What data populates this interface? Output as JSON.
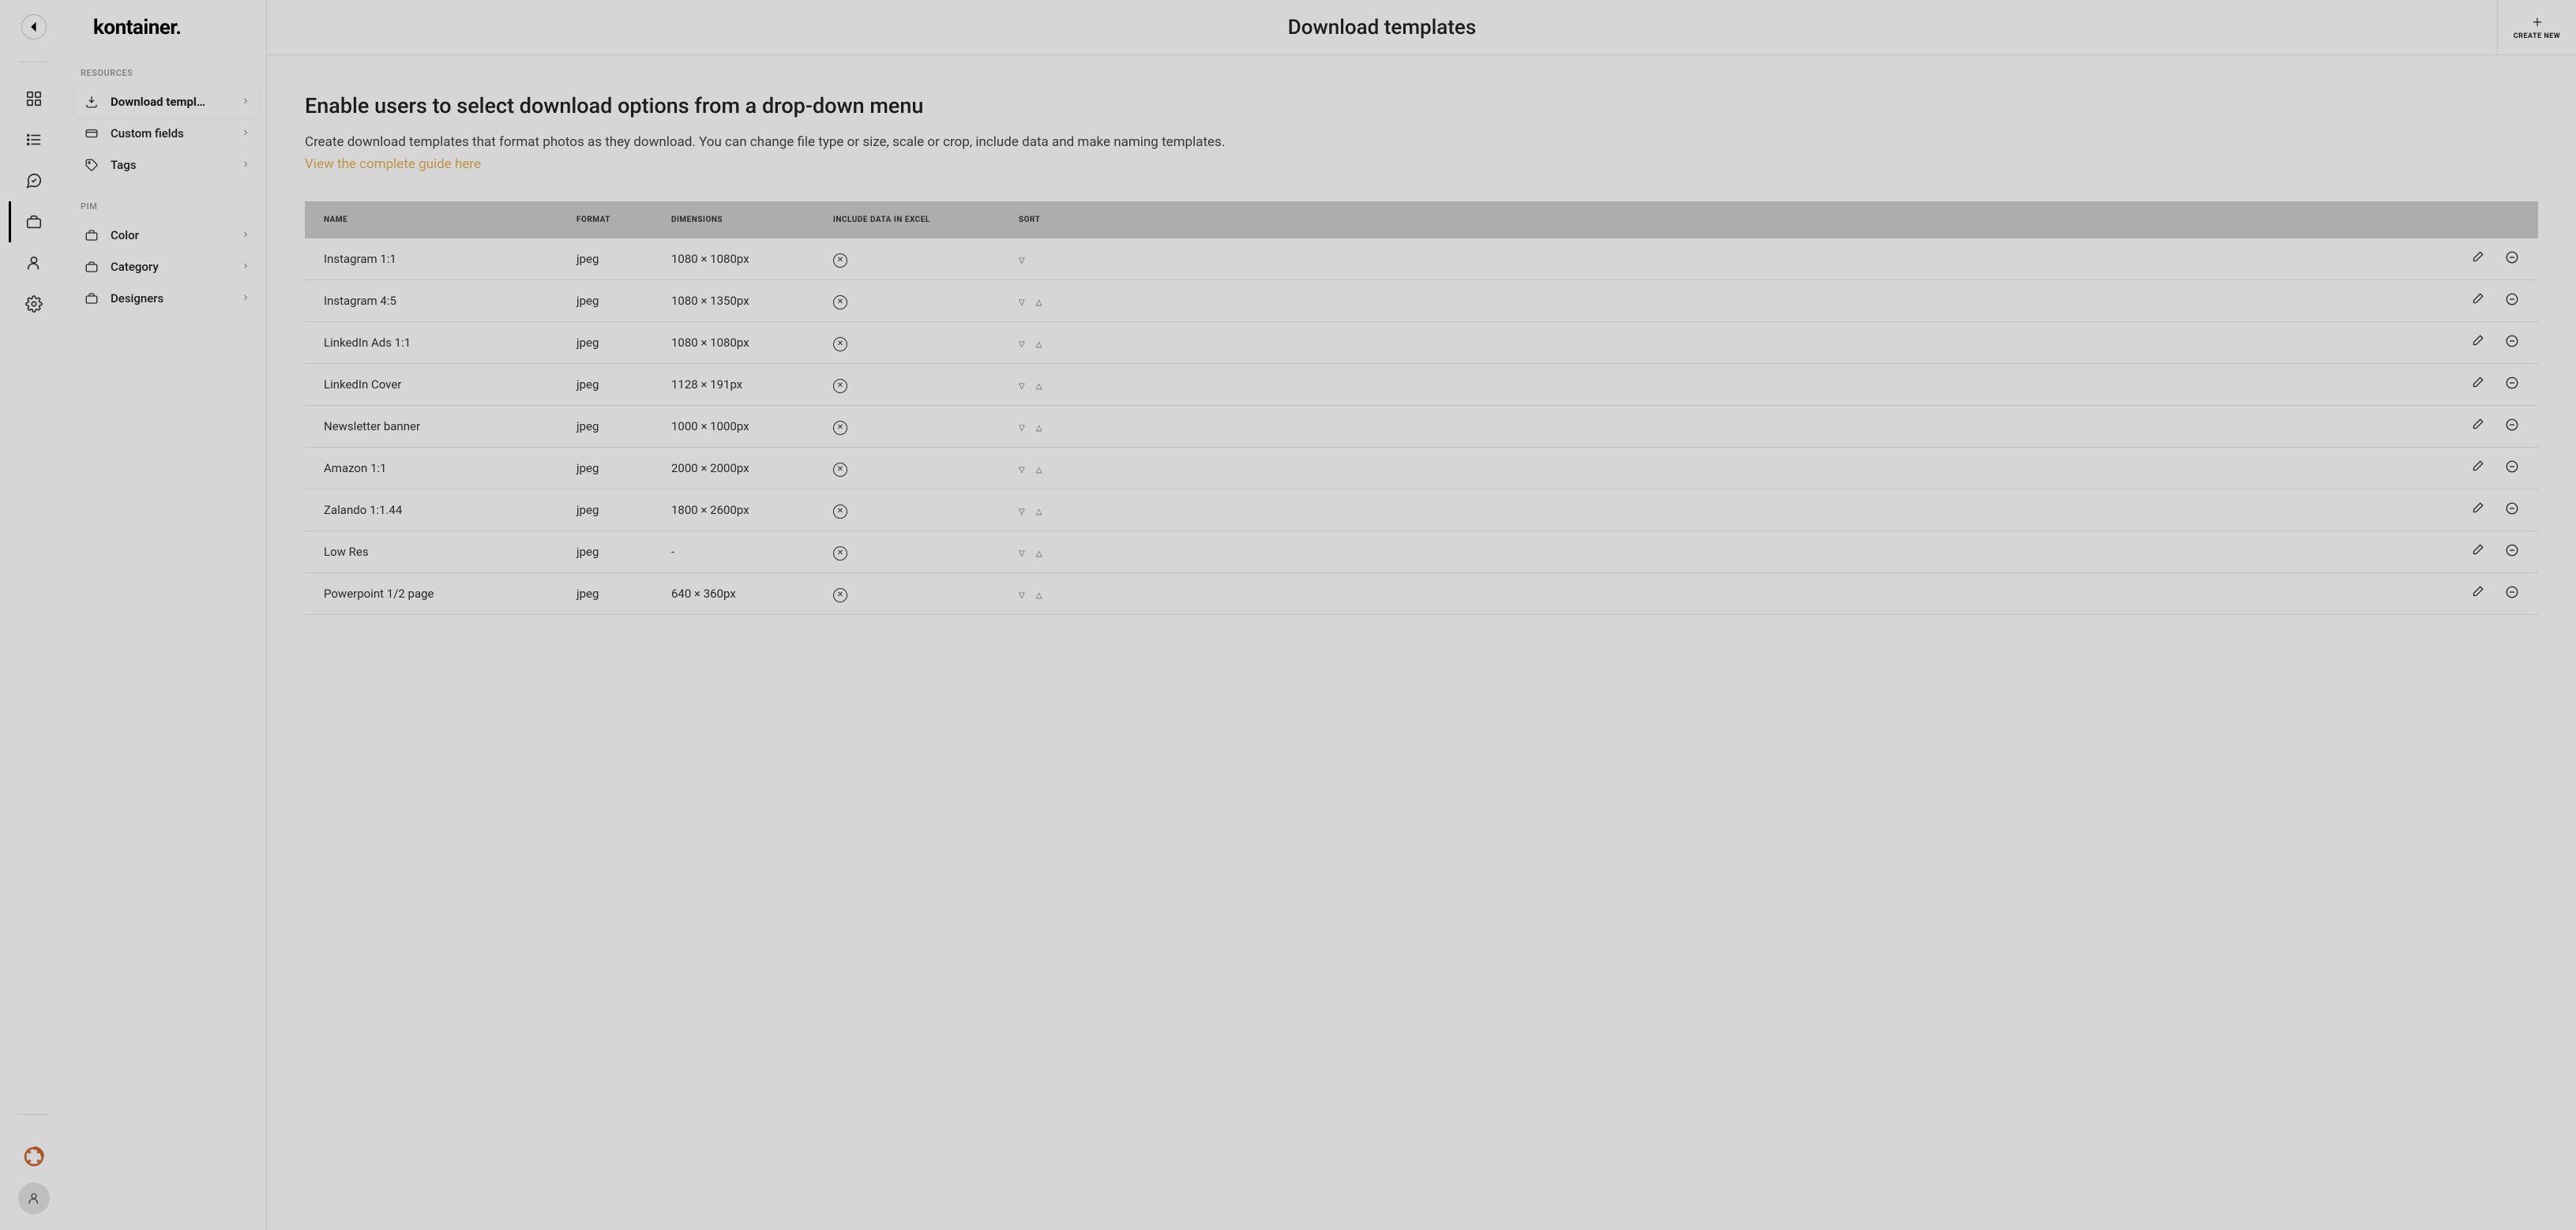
{
  "logo": "kontainer.",
  "sidebar": {
    "section_resources": "RESOURCES",
    "section_pim": "PIM",
    "resources": [
      {
        "label": "Download templ…"
      },
      {
        "label": "Custom fields"
      },
      {
        "label": "Tags"
      }
    ],
    "pim": [
      {
        "label": "Color"
      },
      {
        "label": "Category"
      },
      {
        "label": "Designers"
      }
    ]
  },
  "header": {
    "title": "Download templates",
    "create_new": "CREATE NEW"
  },
  "content": {
    "heading": "Enable users to select download options from a drop-down menu",
    "desc": "Create download templates that format photos as they download. You can change file type or size, scale or crop, include data and make naming templates.",
    "guide_link": "View the complete guide here"
  },
  "table": {
    "head": {
      "name": "NAME",
      "format": "FORMAT",
      "dimensions": "DIMENSIONS",
      "include_excel": "INCLUDE DATA IN EXCEL",
      "sort": "SORT"
    },
    "rows": [
      {
        "name": "Instagram 1:1",
        "format": "jpeg",
        "dimensions": "1080 × 1080px",
        "up": false,
        "down": true,
        "include_excel": false
      },
      {
        "name": "Instagram 4:5",
        "format": "jpeg",
        "dimensions": "1080 × 1350px",
        "up": true,
        "down": true,
        "include_excel": false
      },
      {
        "name": "LinkedIn Ads 1:1",
        "format": "jpeg",
        "dimensions": "1080 × 1080px",
        "up": true,
        "down": true,
        "include_excel": false
      },
      {
        "name": "LinkedIn Cover",
        "format": "jpeg",
        "dimensions": "1128 × 191px",
        "up": true,
        "down": true,
        "include_excel": false
      },
      {
        "name": "Newsletter banner",
        "format": "jpeg",
        "dimensions": "1000 × 1000px",
        "up": true,
        "down": true,
        "include_excel": false
      },
      {
        "name": "Amazon 1:1",
        "format": "jpeg",
        "dimensions": "2000 × 2000px",
        "up": true,
        "down": true,
        "include_excel": false
      },
      {
        "name": "Zalando 1:1.44",
        "format": "jpeg",
        "dimensions": "1800 × 2600px",
        "up": true,
        "down": true,
        "include_excel": false
      },
      {
        "name": "Low Res",
        "format": "jpeg",
        "dimensions": "-",
        "up": true,
        "down": true,
        "include_excel": false
      },
      {
        "name": "Powerpoint 1/2 page",
        "format": "jpeg",
        "dimensions": "640 × 360px",
        "up": true,
        "down": true,
        "include_excel": false
      }
    ]
  }
}
